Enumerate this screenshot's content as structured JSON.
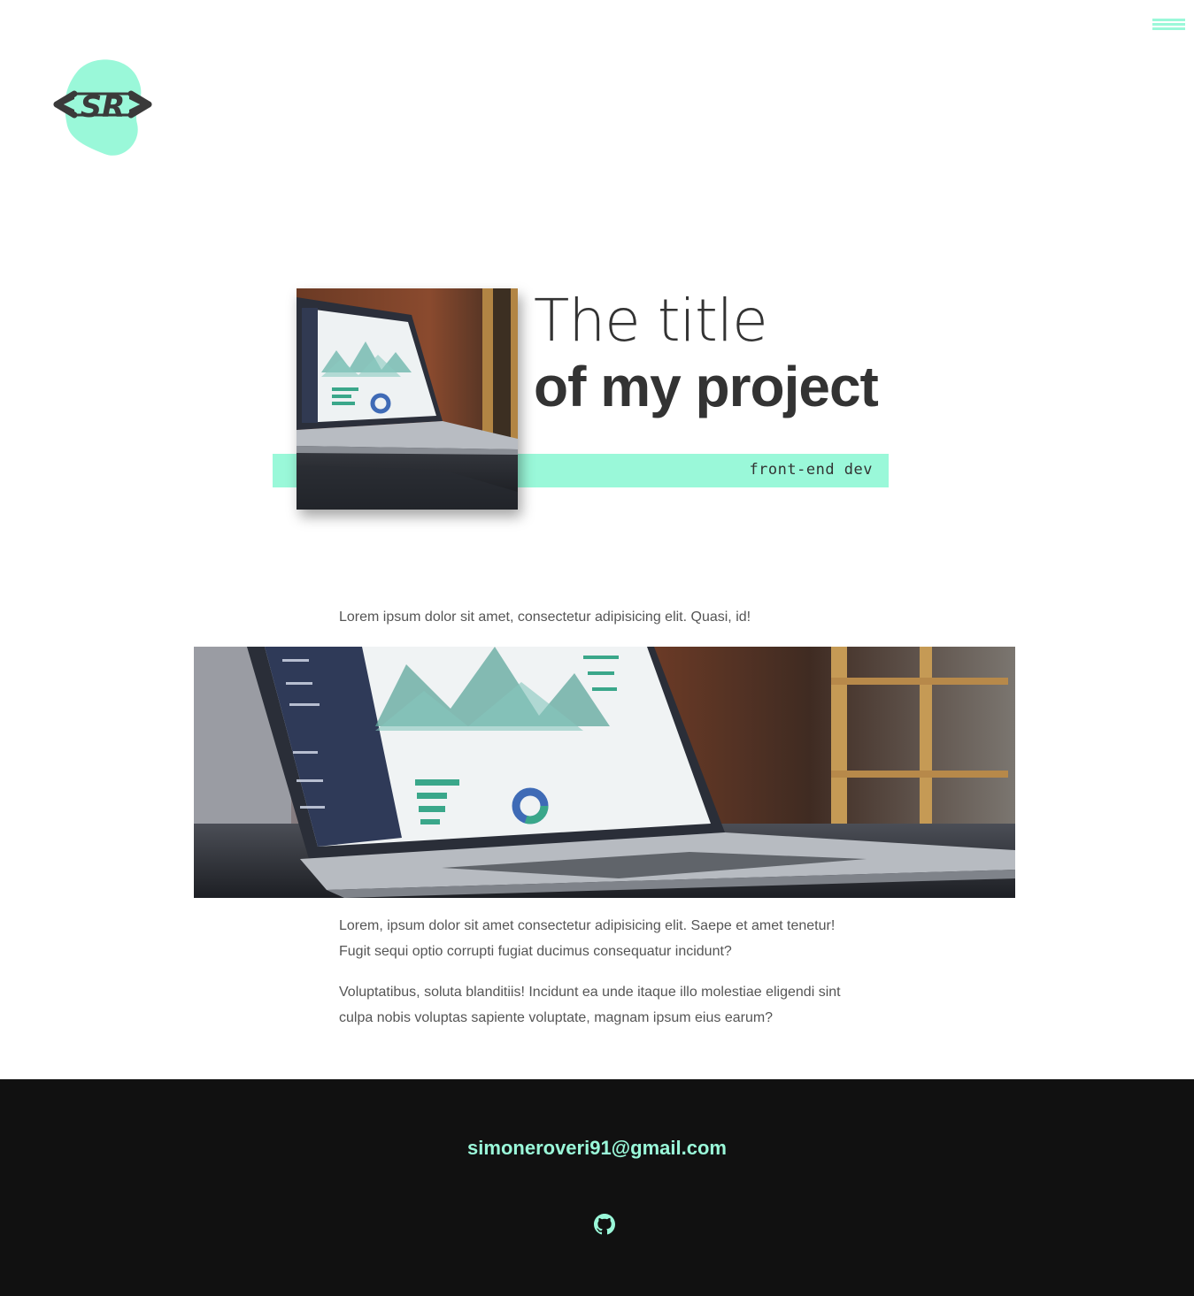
{
  "header": {
    "menu_icon": "hamburger-menu-icon",
    "logo_alt": "SR"
  },
  "hero": {
    "title_line1": "The title",
    "title_line2": "of my project",
    "tag": "front-end dev",
    "accent_color": "#9af8d9"
  },
  "content": {
    "intro": "Lorem ipsum dolor sit amet, consectetur adipisicing elit. Quasi, id!",
    "paragraph1": "Lorem, ipsum dolor sit amet consectetur adipisicing elit. Saepe et amet tenetur! Fugit sequi optio corrupti fugiat ducimus consequatur incidunt?",
    "paragraph2": "Voluptatibus, soluta blanditiis! Incidunt ea unde itaque illo molestiae eligendi sint culpa nobis voluptas sapiente voluptate, magnam ipsum eius earum?"
  },
  "footer": {
    "email": "simoneroveri91@gmail.com",
    "github_icon": "github-icon",
    "background": "#111111"
  }
}
